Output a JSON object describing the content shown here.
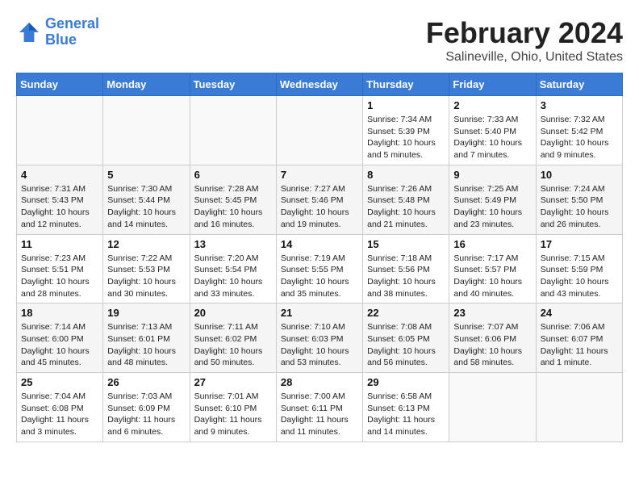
{
  "header": {
    "month_year": "February 2024",
    "location": "Salineville, Ohio, United States"
  },
  "logo": {
    "line1": "General",
    "line2": "Blue"
  },
  "days_of_week": [
    "Sunday",
    "Monday",
    "Tuesday",
    "Wednesday",
    "Thursday",
    "Friday",
    "Saturday"
  ],
  "weeks": [
    [
      {
        "day": "",
        "info": ""
      },
      {
        "day": "",
        "info": ""
      },
      {
        "day": "",
        "info": ""
      },
      {
        "day": "",
        "info": ""
      },
      {
        "day": "1",
        "info": "Sunrise: 7:34 AM\nSunset: 5:39 PM\nDaylight: 10 hours\nand 5 minutes."
      },
      {
        "day": "2",
        "info": "Sunrise: 7:33 AM\nSunset: 5:40 PM\nDaylight: 10 hours\nand 7 minutes."
      },
      {
        "day": "3",
        "info": "Sunrise: 7:32 AM\nSunset: 5:42 PM\nDaylight: 10 hours\nand 9 minutes."
      }
    ],
    [
      {
        "day": "4",
        "info": "Sunrise: 7:31 AM\nSunset: 5:43 PM\nDaylight: 10 hours\nand 12 minutes."
      },
      {
        "day": "5",
        "info": "Sunrise: 7:30 AM\nSunset: 5:44 PM\nDaylight: 10 hours\nand 14 minutes."
      },
      {
        "day": "6",
        "info": "Sunrise: 7:28 AM\nSunset: 5:45 PM\nDaylight: 10 hours\nand 16 minutes."
      },
      {
        "day": "7",
        "info": "Sunrise: 7:27 AM\nSunset: 5:46 PM\nDaylight: 10 hours\nand 19 minutes."
      },
      {
        "day": "8",
        "info": "Sunrise: 7:26 AM\nSunset: 5:48 PM\nDaylight: 10 hours\nand 21 minutes."
      },
      {
        "day": "9",
        "info": "Sunrise: 7:25 AM\nSunset: 5:49 PM\nDaylight: 10 hours\nand 23 minutes."
      },
      {
        "day": "10",
        "info": "Sunrise: 7:24 AM\nSunset: 5:50 PM\nDaylight: 10 hours\nand 26 minutes."
      }
    ],
    [
      {
        "day": "11",
        "info": "Sunrise: 7:23 AM\nSunset: 5:51 PM\nDaylight: 10 hours\nand 28 minutes."
      },
      {
        "day": "12",
        "info": "Sunrise: 7:22 AM\nSunset: 5:53 PM\nDaylight: 10 hours\nand 30 minutes."
      },
      {
        "day": "13",
        "info": "Sunrise: 7:20 AM\nSunset: 5:54 PM\nDaylight: 10 hours\nand 33 minutes."
      },
      {
        "day": "14",
        "info": "Sunrise: 7:19 AM\nSunset: 5:55 PM\nDaylight: 10 hours\nand 35 minutes."
      },
      {
        "day": "15",
        "info": "Sunrise: 7:18 AM\nSunset: 5:56 PM\nDaylight: 10 hours\nand 38 minutes."
      },
      {
        "day": "16",
        "info": "Sunrise: 7:17 AM\nSunset: 5:57 PM\nDaylight: 10 hours\nand 40 minutes."
      },
      {
        "day": "17",
        "info": "Sunrise: 7:15 AM\nSunset: 5:59 PM\nDaylight: 10 hours\nand 43 minutes."
      }
    ],
    [
      {
        "day": "18",
        "info": "Sunrise: 7:14 AM\nSunset: 6:00 PM\nDaylight: 10 hours\nand 45 minutes."
      },
      {
        "day": "19",
        "info": "Sunrise: 7:13 AM\nSunset: 6:01 PM\nDaylight: 10 hours\nand 48 minutes."
      },
      {
        "day": "20",
        "info": "Sunrise: 7:11 AM\nSunset: 6:02 PM\nDaylight: 10 hours\nand 50 minutes."
      },
      {
        "day": "21",
        "info": "Sunrise: 7:10 AM\nSunset: 6:03 PM\nDaylight: 10 hours\nand 53 minutes."
      },
      {
        "day": "22",
        "info": "Sunrise: 7:08 AM\nSunset: 6:05 PM\nDaylight: 10 hours\nand 56 minutes."
      },
      {
        "day": "23",
        "info": "Sunrise: 7:07 AM\nSunset: 6:06 PM\nDaylight: 10 hours\nand 58 minutes."
      },
      {
        "day": "24",
        "info": "Sunrise: 7:06 AM\nSunset: 6:07 PM\nDaylight: 11 hours\nand 1 minute."
      }
    ],
    [
      {
        "day": "25",
        "info": "Sunrise: 7:04 AM\nSunset: 6:08 PM\nDaylight: 11 hours\nand 3 minutes."
      },
      {
        "day": "26",
        "info": "Sunrise: 7:03 AM\nSunset: 6:09 PM\nDaylight: 11 hours\nand 6 minutes."
      },
      {
        "day": "27",
        "info": "Sunrise: 7:01 AM\nSunset: 6:10 PM\nDaylight: 11 hours\nand 9 minutes."
      },
      {
        "day": "28",
        "info": "Sunrise: 7:00 AM\nSunset: 6:11 PM\nDaylight: 11 hours\nand 11 minutes."
      },
      {
        "day": "29",
        "info": "Sunrise: 6:58 AM\nSunset: 6:13 PM\nDaylight: 11 hours\nand 14 minutes."
      },
      {
        "day": "",
        "info": ""
      },
      {
        "day": "",
        "info": ""
      }
    ]
  ]
}
